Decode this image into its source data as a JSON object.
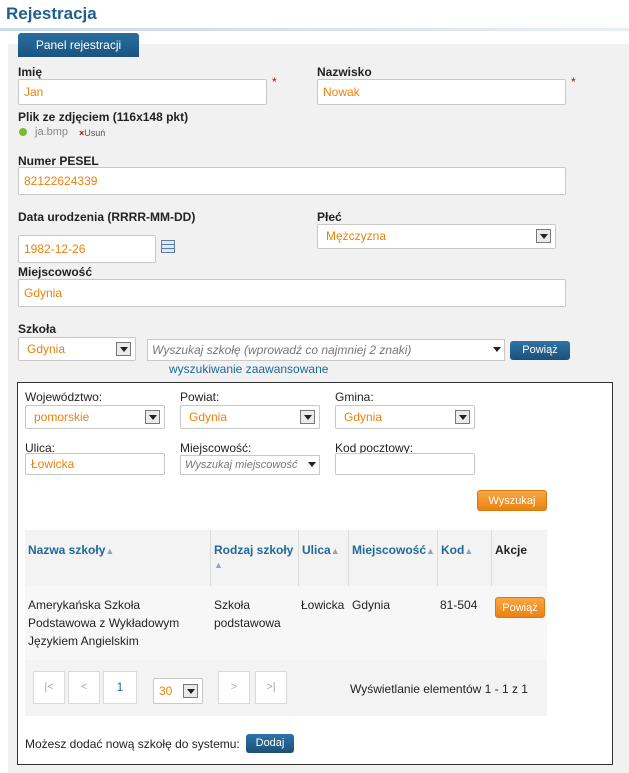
{
  "page": {
    "title": "Rejestracja"
  },
  "tab": {
    "label": "Panel rejestracji"
  },
  "form": {
    "first_name": {
      "label": "Imię",
      "value": "Jan",
      "required": "*"
    },
    "last_name": {
      "label": "Nazwisko",
      "value": "Nowak",
      "required": "*"
    },
    "photo": {
      "label": "Plik ze zdjęciem (116x148 pkt)",
      "file_name": "ja.bmp",
      "remove_label": "Usuń"
    },
    "pesel": {
      "label": "Numer PESEL",
      "value": "82122624339"
    },
    "birth_date": {
      "label": "Data urodzenia (RRRR-MM-DD)",
      "value": "1982-12-26"
    },
    "gender": {
      "label": "Płeć",
      "value": "Mężczyzna"
    },
    "city": {
      "label": "Miejscowość",
      "value": "Gdynia"
    },
    "school": {
      "label": "Szkoła",
      "city_select": "Gdynia",
      "search_placeholder": "Wyszukaj szkołę (wprowadź co najmniej 2 znaki)",
      "link_button": "Powiąż",
      "advanced_link": "wyszukiwanie zaawansowane"
    }
  },
  "advanced": {
    "voivodeship": {
      "label": "Województwo:",
      "value": "pomorskie"
    },
    "county": {
      "label": "Powiat:",
      "value": "Gdynia"
    },
    "commune": {
      "label": "Gmina:",
      "value": "Gdynia"
    },
    "street": {
      "label": "Ulica:",
      "value": "Łowicka"
    },
    "locality": {
      "label": "Miejscowość:",
      "placeholder": "Wyszukaj miejscowość"
    },
    "postal_code": {
      "label": "Kod pocztowy:",
      "value": ""
    },
    "search_button": "Wyszukaj",
    "table": {
      "headers": [
        "Nazwa szkoły",
        "Rodzaj szkoły",
        "Ulica",
        "Miejscowość",
        "Kod",
        "Akcje"
      ],
      "rows": [
        {
          "name_lines": [
            "Amerykańska Szkoła",
            "Podstawowa z Wykładowym",
            "Językiem Angielskim"
          ],
          "type_lines": [
            "Szkoła",
            "podstawowa"
          ],
          "street": "Łowicka",
          "city": "Gdynia",
          "code": "81-504",
          "action": "Powiąż"
        }
      ]
    },
    "pager": {
      "first": "|<",
      "prev": "<",
      "current_page": "1",
      "page_size": "30",
      "next": ">",
      "last": ">|",
      "info": "Wyświetlanie elementów 1 - 1 z 1"
    },
    "add_school": {
      "text": "Możesz dodać nową szkołę do systemu:",
      "button": "Dodaj"
    }
  },
  "icons": {
    "calendar": "calendar-icon",
    "dropdown": "chevron-down-icon",
    "file_status": "green-dot-icon",
    "remove": "close-icon"
  },
  "colors": {
    "accent": "#1f5e8e",
    "value_text": "#e8820c",
    "link": "#1d6a9a",
    "button_orange": "#f39a2c"
  }
}
